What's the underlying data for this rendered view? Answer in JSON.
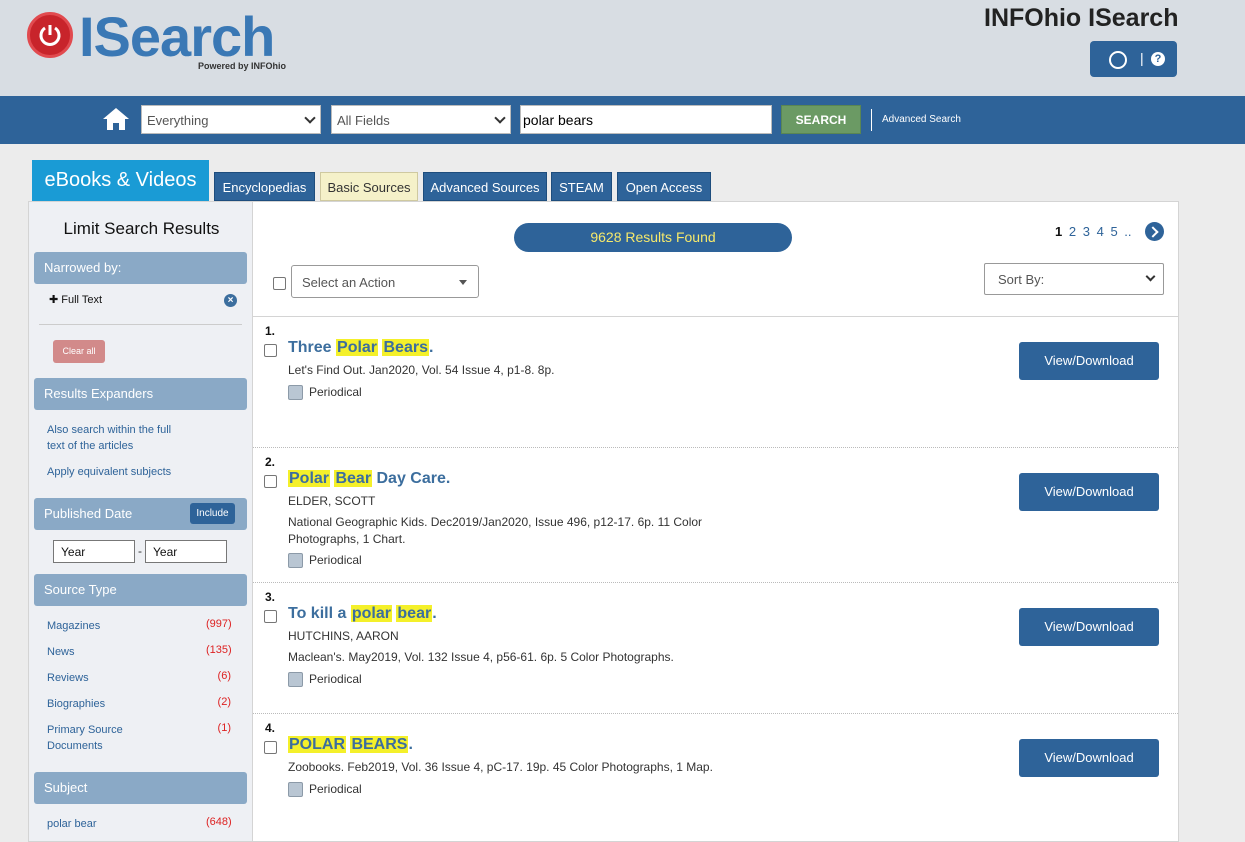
{
  "header": {
    "logo_text": "ISearch",
    "logo_sub": "Powered by INFOhio",
    "site_title": "INFOhio ISearch",
    "util_sep": "|",
    "help_label": "?"
  },
  "search": {
    "scope": "Everything",
    "field": "All Fields",
    "query": "polar bears",
    "button": "SEARCH",
    "advanced": "Advanced Search"
  },
  "tabs": [
    {
      "label": "eBooks & Videos"
    },
    {
      "label": "Encyclopedias"
    },
    {
      "label": "Basic Sources"
    },
    {
      "label": "Advanced Sources"
    },
    {
      "label": "STEAM"
    },
    {
      "label": "Open Access"
    }
  ],
  "sidebar": {
    "title": "Limit Search Results",
    "narrowed_head": "Narrowed by:",
    "full_text": "Full Text",
    "remove_label": "×",
    "clear_all": "Clear all",
    "expanders_head": "Results Expanders",
    "expanders": [
      "Also search within the full text of the articles",
      "Apply equivalent subjects"
    ],
    "published_head": "Published Date",
    "include": "Include",
    "year_from": "Year",
    "year_sep": "-",
    "year_to": "Year",
    "source_head": "Source Type",
    "sources": [
      {
        "label": "Magazines",
        "count": "(997)"
      },
      {
        "label": "News",
        "count": "(135)"
      },
      {
        "label": "Reviews",
        "count": "(6)"
      },
      {
        "label": "Biographies",
        "count": "(2)"
      },
      {
        "label": "Primary Source Documents",
        "count": "(1)"
      }
    ],
    "subject_head": "Subject",
    "subjects": [
      {
        "label": "polar bear",
        "count": "(648)"
      }
    ]
  },
  "results": {
    "found": "9628 Results Found",
    "pages": [
      "1",
      "2",
      "3",
      "4",
      "5",
      ".."
    ],
    "action": "Select an Action",
    "sort": "Sort By:",
    "view_label": "View/Download",
    "items": [
      {
        "num": "1.",
        "title_parts": [
          {
            "t": "Three ",
            "h": false
          },
          {
            "t": "Polar",
            "h": true
          },
          {
            "t": " ",
            "h": false
          },
          {
            "t": "Bears",
            "h": true
          },
          {
            "t": ".",
            "h": false
          }
        ],
        "author": "",
        "source": "Let's Find Out. Jan2020, Vol. 54 Issue 4, p1-8. 8p.",
        "type": "Periodical"
      },
      {
        "num": "2.",
        "title_parts": [
          {
            "t": "Polar",
            "h": true
          },
          {
            "t": " ",
            "h": false
          },
          {
            "t": "Bear",
            "h": true
          },
          {
            "t": " Day Care.",
            "h": false
          }
        ],
        "author": "ELDER, SCOTT",
        "source": "National Geographic Kids. Dec2019/Jan2020, Issue 496, p12-17. 6p. 11 Color Photographs, 1 Chart.",
        "type": "Periodical"
      },
      {
        "num": "3.",
        "title_parts": [
          {
            "t": "To kill a ",
            "h": false
          },
          {
            "t": "polar",
            "h": true
          },
          {
            "t": " ",
            "h": false
          },
          {
            "t": "bear",
            "h": true
          },
          {
            "t": ".",
            "h": false
          }
        ],
        "author": "HUTCHINS, AARON",
        "source": "Maclean's. May2019, Vol. 132 Issue 4, p56-61. 6p. 5 Color Photographs.",
        "type": "Periodical"
      },
      {
        "num": "4.",
        "title_parts": [
          {
            "t": "POLAR",
            "h": true
          },
          {
            "t": " ",
            "h": false
          },
          {
            "t": "BEARS",
            "h": true
          },
          {
            "t": ".",
            "h": false
          }
        ],
        "author": "",
        "source": "Zoobooks. Feb2019, Vol. 36 Issue 4, pC-17. 19p. 45 Color Photographs, 1 Map.",
        "type": "Periodical"
      }
    ]
  }
}
